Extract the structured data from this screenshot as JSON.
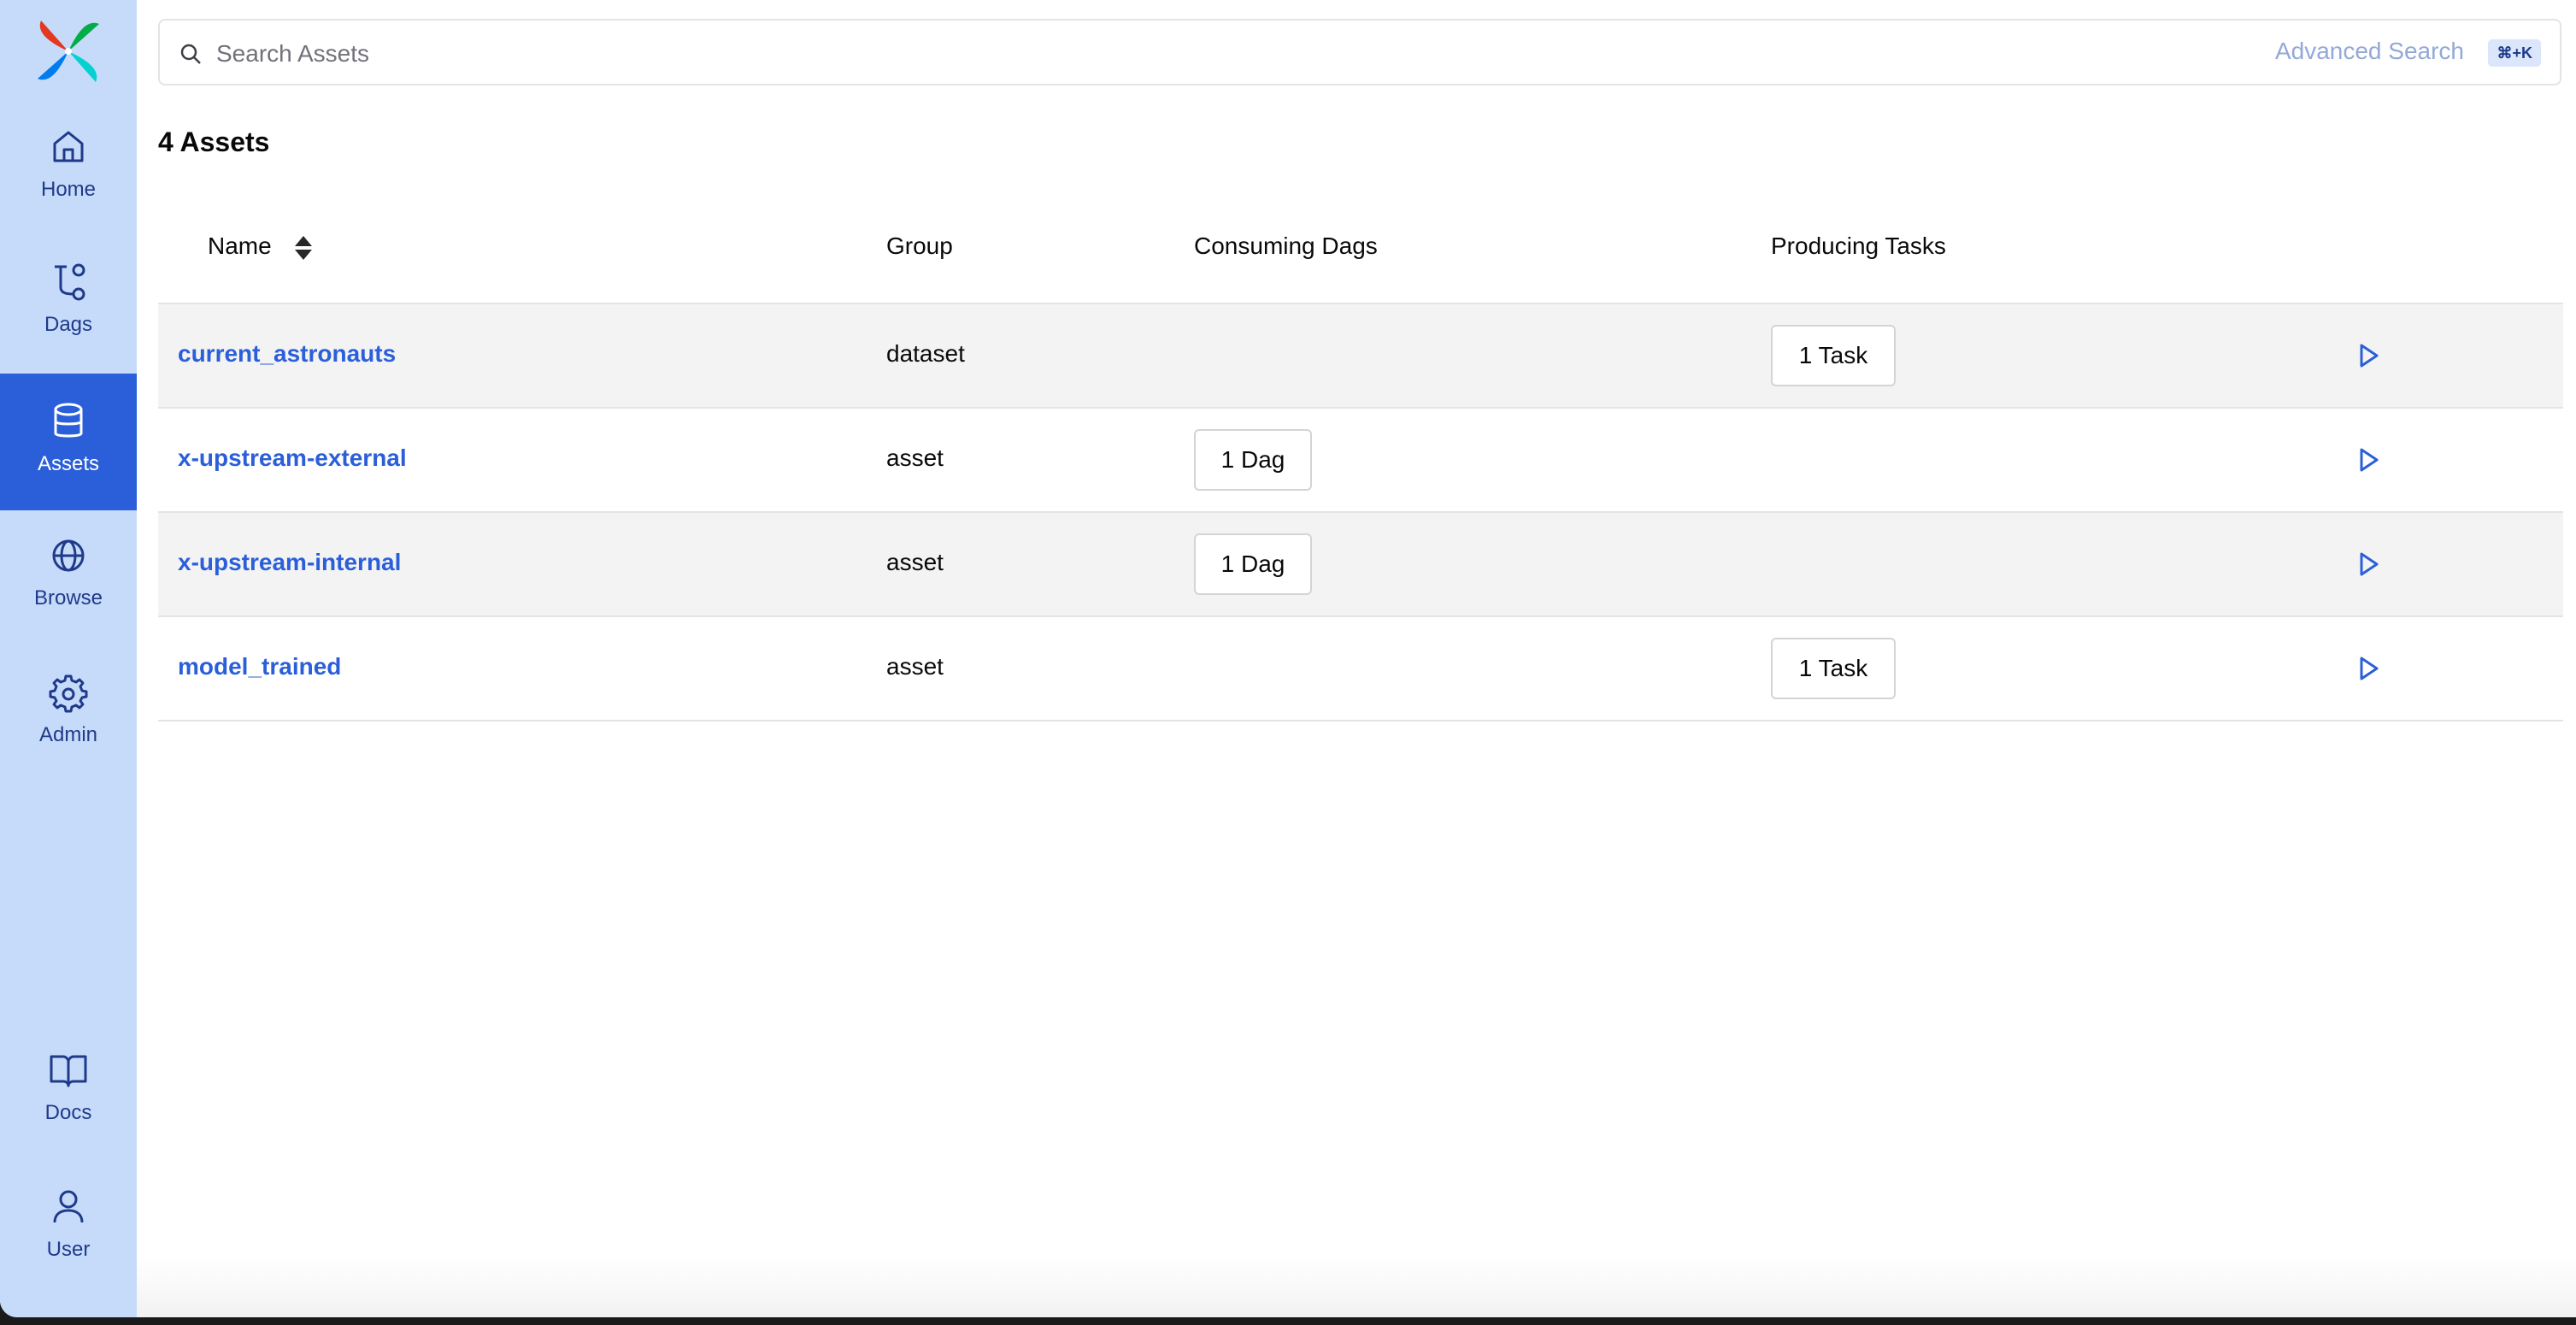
{
  "colors": {
    "sidebar_bg": "#c6dbfa",
    "active_nav": "#2b5fd9",
    "link": "#2b5fd9",
    "row_alt": "#f3f3f4"
  },
  "sidebar": {
    "items": [
      {
        "label": "Home",
        "icon": "home-icon"
      },
      {
        "label": "Dags",
        "icon": "dags-icon"
      },
      {
        "label": "Assets",
        "icon": "database-icon",
        "active": true
      },
      {
        "label": "Browse",
        "icon": "globe-icon"
      },
      {
        "label": "Admin",
        "icon": "gear-icon"
      },
      {
        "label": "Docs",
        "icon": "book-icon"
      },
      {
        "label": "User",
        "icon": "user-icon"
      }
    ]
  },
  "search": {
    "placeholder": "Search Assets",
    "advanced_label": "Advanced Search",
    "shortcut": "⌘+K"
  },
  "assets_count_label": "4 Assets",
  "table": {
    "columns": [
      "Name",
      "Group",
      "Consuming Dags",
      "Producing Tasks"
    ],
    "rows": [
      {
        "name": "current_astronauts",
        "group": "dataset",
        "consuming": "",
        "producing": "1 Task"
      },
      {
        "name": "x-upstream-external",
        "group": "asset",
        "consuming": "1 Dag",
        "producing": ""
      },
      {
        "name": "x-upstream-internal",
        "group": "asset",
        "consuming": "1 Dag",
        "producing": ""
      },
      {
        "name": "model_trained",
        "group": "asset",
        "consuming": "",
        "producing": "1 Task"
      }
    ]
  }
}
